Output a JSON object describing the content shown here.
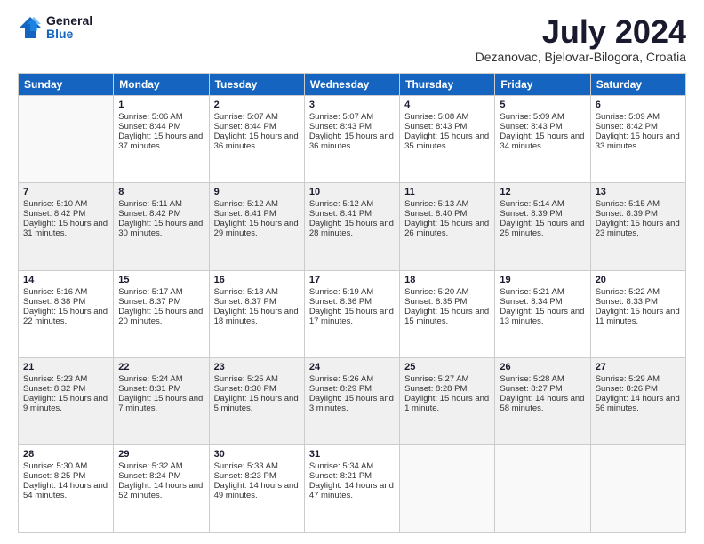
{
  "logo": {
    "general": "General",
    "blue": "Blue"
  },
  "title": {
    "month_year": "July 2024",
    "location": "Dezanovac, Bjelovar-Bilogora, Croatia"
  },
  "headers": [
    "Sunday",
    "Monday",
    "Tuesday",
    "Wednesday",
    "Thursday",
    "Friday",
    "Saturday"
  ],
  "weeks": [
    [
      {
        "day": "",
        "sunrise": "",
        "sunset": "",
        "daylight": ""
      },
      {
        "day": "1",
        "sunrise": "Sunrise: 5:06 AM",
        "sunset": "Sunset: 8:44 PM",
        "daylight": "Daylight: 15 hours and 37 minutes."
      },
      {
        "day": "2",
        "sunrise": "Sunrise: 5:07 AM",
        "sunset": "Sunset: 8:44 PM",
        "daylight": "Daylight: 15 hours and 36 minutes."
      },
      {
        "day": "3",
        "sunrise": "Sunrise: 5:07 AM",
        "sunset": "Sunset: 8:43 PM",
        "daylight": "Daylight: 15 hours and 36 minutes."
      },
      {
        "day": "4",
        "sunrise": "Sunrise: 5:08 AM",
        "sunset": "Sunset: 8:43 PM",
        "daylight": "Daylight: 15 hours and 35 minutes."
      },
      {
        "day": "5",
        "sunrise": "Sunrise: 5:09 AM",
        "sunset": "Sunset: 8:43 PM",
        "daylight": "Daylight: 15 hours and 34 minutes."
      },
      {
        "day": "6",
        "sunrise": "Sunrise: 5:09 AM",
        "sunset": "Sunset: 8:42 PM",
        "daylight": "Daylight: 15 hours and 33 minutes."
      }
    ],
    [
      {
        "day": "7",
        "sunrise": "Sunrise: 5:10 AM",
        "sunset": "Sunset: 8:42 PM",
        "daylight": "Daylight: 15 hours and 31 minutes."
      },
      {
        "day": "8",
        "sunrise": "Sunrise: 5:11 AM",
        "sunset": "Sunset: 8:42 PM",
        "daylight": "Daylight: 15 hours and 30 minutes."
      },
      {
        "day": "9",
        "sunrise": "Sunrise: 5:12 AM",
        "sunset": "Sunset: 8:41 PM",
        "daylight": "Daylight: 15 hours and 29 minutes."
      },
      {
        "day": "10",
        "sunrise": "Sunrise: 5:12 AM",
        "sunset": "Sunset: 8:41 PM",
        "daylight": "Daylight: 15 hours and 28 minutes."
      },
      {
        "day": "11",
        "sunrise": "Sunrise: 5:13 AM",
        "sunset": "Sunset: 8:40 PM",
        "daylight": "Daylight: 15 hours and 26 minutes."
      },
      {
        "day": "12",
        "sunrise": "Sunrise: 5:14 AM",
        "sunset": "Sunset: 8:39 PM",
        "daylight": "Daylight: 15 hours and 25 minutes."
      },
      {
        "day": "13",
        "sunrise": "Sunrise: 5:15 AM",
        "sunset": "Sunset: 8:39 PM",
        "daylight": "Daylight: 15 hours and 23 minutes."
      }
    ],
    [
      {
        "day": "14",
        "sunrise": "Sunrise: 5:16 AM",
        "sunset": "Sunset: 8:38 PM",
        "daylight": "Daylight: 15 hours and 22 minutes."
      },
      {
        "day": "15",
        "sunrise": "Sunrise: 5:17 AM",
        "sunset": "Sunset: 8:37 PM",
        "daylight": "Daylight: 15 hours and 20 minutes."
      },
      {
        "day": "16",
        "sunrise": "Sunrise: 5:18 AM",
        "sunset": "Sunset: 8:37 PM",
        "daylight": "Daylight: 15 hours and 18 minutes."
      },
      {
        "day": "17",
        "sunrise": "Sunrise: 5:19 AM",
        "sunset": "Sunset: 8:36 PM",
        "daylight": "Daylight: 15 hours and 17 minutes."
      },
      {
        "day": "18",
        "sunrise": "Sunrise: 5:20 AM",
        "sunset": "Sunset: 8:35 PM",
        "daylight": "Daylight: 15 hours and 15 minutes."
      },
      {
        "day": "19",
        "sunrise": "Sunrise: 5:21 AM",
        "sunset": "Sunset: 8:34 PM",
        "daylight": "Daylight: 15 hours and 13 minutes."
      },
      {
        "day": "20",
        "sunrise": "Sunrise: 5:22 AM",
        "sunset": "Sunset: 8:33 PM",
        "daylight": "Daylight: 15 hours and 11 minutes."
      }
    ],
    [
      {
        "day": "21",
        "sunrise": "Sunrise: 5:23 AM",
        "sunset": "Sunset: 8:32 PM",
        "daylight": "Daylight: 15 hours and 9 minutes."
      },
      {
        "day": "22",
        "sunrise": "Sunrise: 5:24 AM",
        "sunset": "Sunset: 8:31 PM",
        "daylight": "Daylight: 15 hours and 7 minutes."
      },
      {
        "day": "23",
        "sunrise": "Sunrise: 5:25 AM",
        "sunset": "Sunset: 8:30 PM",
        "daylight": "Daylight: 15 hours and 5 minutes."
      },
      {
        "day": "24",
        "sunrise": "Sunrise: 5:26 AM",
        "sunset": "Sunset: 8:29 PM",
        "daylight": "Daylight: 15 hours and 3 minutes."
      },
      {
        "day": "25",
        "sunrise": "Sunrise: 5:27 AM",
        "sunset": "Sunset: 8:28 PM",
        "daylight": "Daylight: 15 hours and 1 minute."
      },
      {
        "day": "26",
        "sunrise": "Sunrise: 5:28 AM",
        "sunset": "Sunset: 8:27 PM",
        "daylight": "Daylight: 14 hours and 58 minutes."
      },
      {
        "day": "27",
        "sunrise": "Sunrise: 5:29 AM",
        "sunset": "Sunset: 8:26 PM",
        "daylight": "Daylight: 14 hours and 56 minutes."
      }
    ],
    [
      {
        "day": "28",
        "sunrise": "Sunrise: 5:30 AM",
        "sunset": "Sunset: 8:25 PM",
        "daylight": "Daylight: 14 hours and 54 minutes."
      },
      {
        "day": "29",
        "sunrise": "Sunrise: 5:32 AM",
        "sunset": "Sunset: 8:24 PM",
        "daylight": "Daylight: 14 hours and 52 minutes."
      },
      {
        "day": "30",
        "sunrise": "Sunrise: 5:33 AM",
        "sunset": "Sunset: 8:23 PM",
        "daylight": "Daylight: 14 hours and 49 minutes."
      },
      {
        "day": "31",
        "sunrise": "Sunrise: 5:34 AM",
        "sunset": "Sunset: 8:21 PM",
        "daylight": "Daylight: 14 hours and 47 minutes."
      },
      {
        "day": "",
        "sunrise": "",
        "sunset": "",
        "daylight": ""
      },
      {
        "day": "",
        "sunrise": "",
        "sunset": "",
        "daylight": ""
      },
      {
        "day": "",
        "sunrise": "",
        "sunset": "",
        "daylight": ""
      }
    ]
  ]
}
